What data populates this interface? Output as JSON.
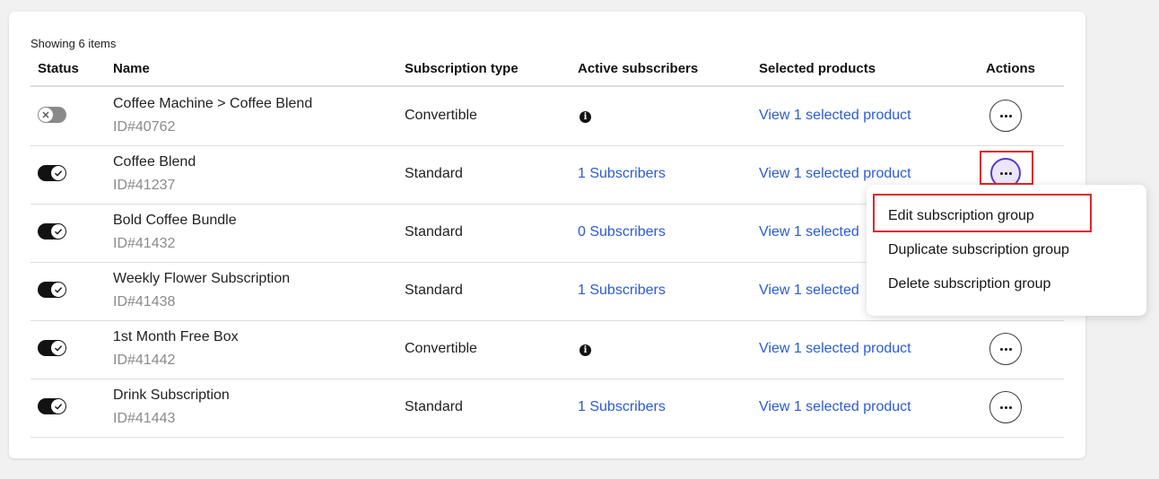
{
  "summary": "Showing 6 items",
  "columns": {
    "status": "Status",
    "name": "Name",
    "type": "Subscription type",
    "subscribers": "Active subscribers",
    "products": "Selected products",
    "actions": "Actions"
  },
  "rows": [
    {
      "name": "Coffee Machine > Coffee Blend",
      "id": "ID#40762",
      "enabled": false,
      "type": "Convertible",
      "subscribers": "",
      "subscribers_icon": "info-icon",
      "products": "View 1 selected product"
    },
    {
      "name": "Coffee Blend",
      "id": "ID#41237",
      "enabled": true,
      "type": "Standard",
      "subscribers": "1 Subscribers",
      "products": "View 1 selected product"
    },
    {
      "name": "Bold Coffee Bundle",
      "id": "ID#41432",
      "enabled": true,
      "type": "Standard",
      "subscribers": "0 Subscribers",
      "products": "View 1 selected"
    },
    {
      "name": "Weekly Flower Subscription",
      "id": "ID#41438",
      "enabled": true,
      "type": "Standard",
      "subscribers": "1 Subscribers",
      "products": "View 1 selected"
    },
    {
      "name": "1st Month Free Box",
      "id": "ID#41442",
      "enabled": true,
      "type": "Convertible",
      "subscribers": "",
      "subscribers_icon": "info-icon",
      "products": "View 1 selected product"
    },
    {
      "name": "Drink Subscription",
      "id": "ID#41443",
      "enabled": true,
      "type": "Standard",
      "subscribers": "1 Subscribers",
      "products": "View 1 selected product"
    }
  ],
  "actions_menu": {
    "items": [
      "Edit subscription group",
      "Duplicate subscription group",
      "Delete subscription group"
    ]
  },
  "colors": {
    "link": "#2a5bd7",
    "highlight": "#e0262b",
    "active_button": "#5a37d0"
  }
}
